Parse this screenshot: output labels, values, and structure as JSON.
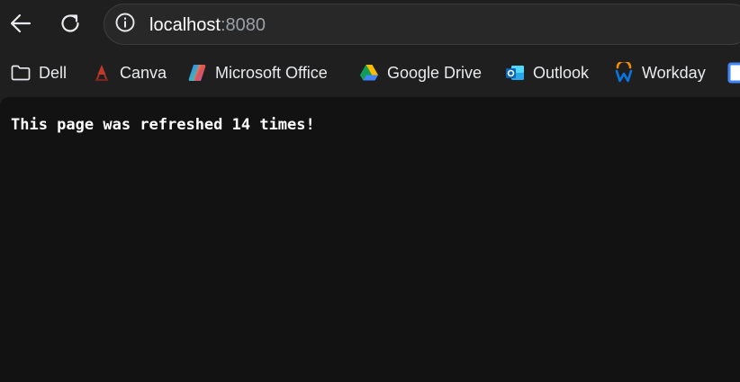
{
  "toolbar": {
    "back_icon": "arrow-left-icon",
    "reload_icon": "reload-icon",
    "site_info_icon": "info-circle-icon",
    "url_host": "localhost",
    "url_port": ":8080"
  },
  "bookmarks": [
    {
      "label": "Dell",
      "icon": "folder-icon"
    },
    {
      "label": "Canva",
      "icon": "canva-logo-icon"
    },
    {
      "label": "Microsoft Office",
      "icon": "microsoft-copilot-icon"
    },
    {
      "label": "Google Drive",
      "icon": "google-drive-icon"
    },
    {
      "label": "Outlook",
      "icon": "outlook-icon"
    },
    {
      "label": "Workday",
      "icon": "workday-icon"
    }
  ],
  "page": {
    "message": "This page was refreshed 14 times!"
  },
  "colors": {
    "toolbar_bg": "#1f1f1f",
    "omnibox_bg": "#282828",
    "page_bg": "#121212",
    "text": "#ffffff",
    "port_text": "#9aa0a6"
  }
}
